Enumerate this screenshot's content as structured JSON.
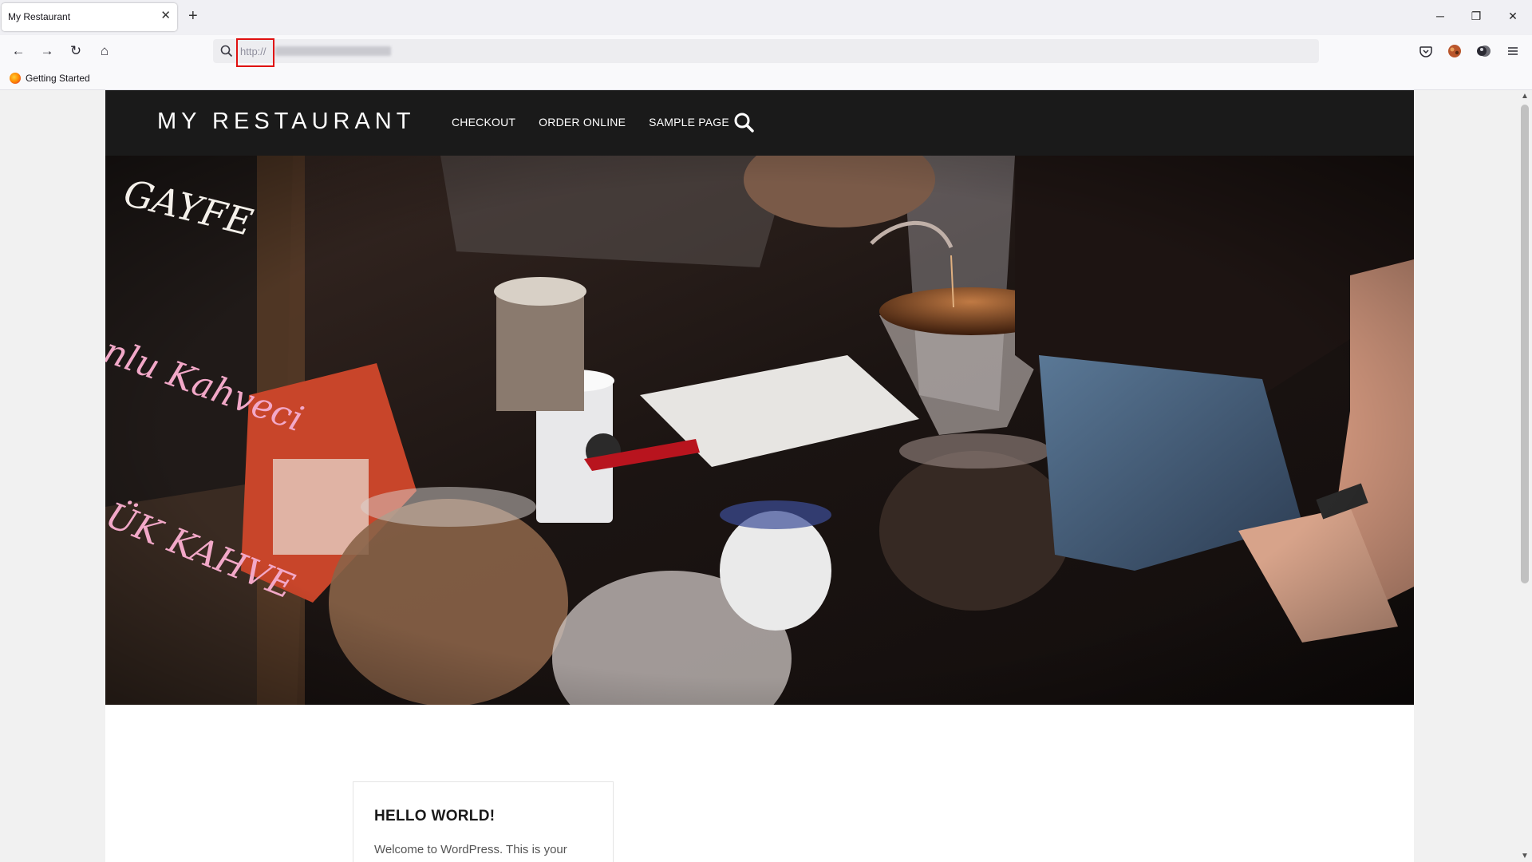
{
  "browser": {
    "tab": {
      "title": "My Restaurant",
      "close": "✕"
    },
    "new_tab": "+",
    "window_controls": {
      "minimize": "─",
      "restore": "❐",
      "close": "✕"
    },
    "nav": {
      "back": "←",
      "forward": "→",
      "reload": "↻",
      "home": "⌂"
    },
    "url": {
      "value": "http://",
      "highlight_color": "#e01010"
    },
    "bookmarks": [
      {
        "label": "Getting Started"
      }
    ]
  },
  "site": {
    "title": "MY RESTAURANT",
    "menu": [
      "CHECKOUT",
      "ORDER ONLINE",
      "SAMPLE PAGE"
    ],
    "header_bg": "#1a1a1a",
    "hero": {
      "chalk_words": [
        "GAYFE",
        "nlu Kahveci",
        "ÜK KAHVE"
      ]
    },
    "post": {
      "title": "HELLO WORLD!",
      "excerpt": "Welcome to WordPress. This is your"
    }
  }
}
